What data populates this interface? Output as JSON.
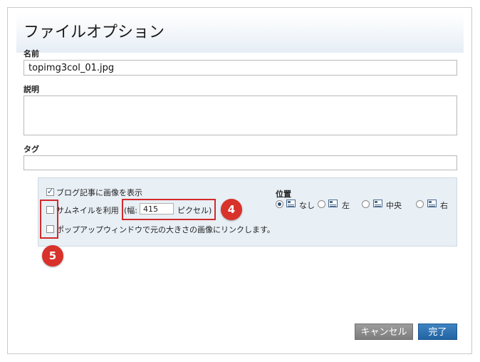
{
  "dialog": {
    "title": "ファイルオプション",
    "name_label": "名前",
    "name_value": "topimg3col_01.jpg",
    "description_label": "説明",
    "description_value": "",
    "tags_label": "タグ",
    "tags_value": ""
  },
  "options": {
    "show_in_post_label": "ブログ記事に画像を表示",
    "show_in_post_checked": true,
    "thumbnail_label": "サムネイルを利用",
    "thumbnail_checked": false,
    "width_prefix": "(幅:",
    "width_value": "415",
    "width_suffix": "ピクセル)",
    "popup_label": "ポップアップウィンドウで元の大きさの画像にリンクします。",
    "popup_checked": false
  },
  "position": {
    "label": "位置",
    "choices": [
      {
        "label": "なし",
        "icon": "align-none-icon",
        "selected": true
      },
      {
        "label": "左",
        "icon": "align-left-icon",
        "selected": false
      },
      {
        "label": "中央",
        "icon": "align-center-icon",
        "selected": false
      },
      {
        "label": "右",
        "icon": "align-right-icon",
        "selected": false
      }
    ]
  },
  "annotations": {
    "badge_4": "4",
    "badge_5": "5",
    "highlight_color": "#d22a2a"
  },
  "buttons": {
    "cancel": "キャンセル",
    "done": "完了"
  }
}
